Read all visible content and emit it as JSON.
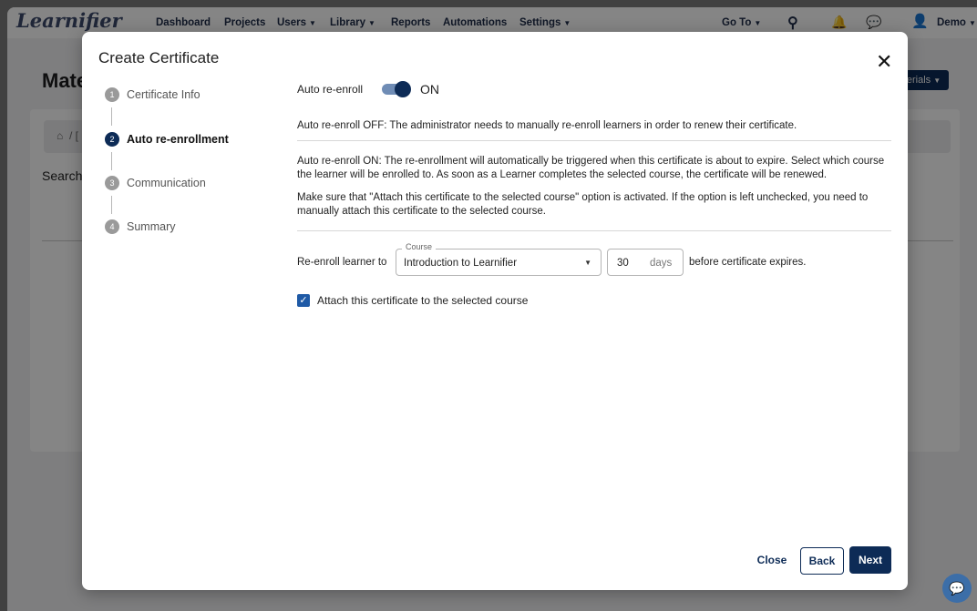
{
  "app": {
    "logo": "Learnifier",
    "nav": [
      {
        "label": "Dashboard"
      },
      {
        "label": "Projects"
      },
      {
        "label": "Users"
      },
      {
        "label": "Library"
      },
      {
        "label": "Reports"
      },
      {
        "label": "Automations"
      },
      {
        "label": "Settings"
      }
    ],
    "goto_label": "Go To",
    "user_label": "Demo",
    "page_title_partial": "Mate",
    "search_partial": "Search",
    "breadcrumb_partial": "/ [",
    "action_button_partial": "erials"
  },
  "modal": {
    "title": "Create Certificate",
    "steps": [
      {
        "num": "1",
        "label": "Certificate Info"
      },
      {
        "num": "2",
        "label": "Auto re-enrollment"
      },
      {
        "num": "3",
        "label": "Communication"
      },
      {
        "num": "4",
        "label": "Summary"
      }
    ],
    "active_step": 2,
    "auto_reenroll_label": "Auto re-enroll",
    "toggle_state": "ON",
    "off_description": "Auto re-enroll OFF: The administrator needs to manually re-enroll learners in order to renew their certificate.",
    "on_description": "Auto re-enroll ON: The re-enrollment will automatically be triggered when this certificate is about to expire. Select which course the learner will be enrolled to. As soon as a Learner completes the selected course, the certificate will be renewed.",
    "attach_note": "Make sure that \"Attach this certificate to the selected course\" option is activated. If the option is left unchecked, you need to manually attach this certificate to the selected course.",
    "reenroll_label": "Re-enroll learner to",
    "course_legend": "Course",
    "course_value": "Introduction to Learnifier",
    "days_value": "30",
    "days_unit": "days",
    "expires_text": "before certificate expires.",
    "attach_checkbox_label": "Attach this certificate to the selected course",
    "attach_checked": true,
    "buttons": {
      "close": "Close",
      "back": "Back",
      "next": "Next"
    }
  },
  "colors": {
    "primary": "#0d2b56",
    "toggle_track": "#6f8cb5",
    "checkbox": "#1f5aa6"
  }
}
